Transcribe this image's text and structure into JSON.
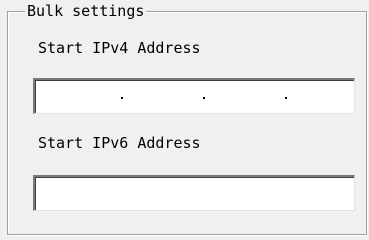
{
  "bulk_settings": {
    "title": "Bulk settings",
    "ipv4": {
      "label": "Start IPv4 Address",
      "octets": [
        "",
        "",
        "",
        ""
      ],
      "separator": "."
    },
    "ipv6": {
      "label": "Start IPv6 Address",
      "value": ""
    }
  }
}
